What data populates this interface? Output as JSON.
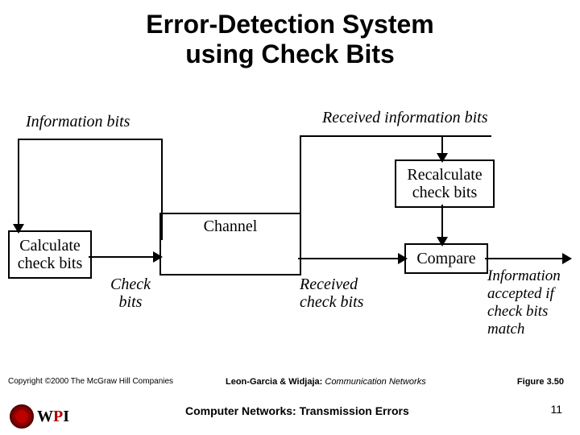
{
  "title_line1": "Error-Detection System",
  "title_line2": "using Check Bits",
  "labels": {
    "info_bits": "Information bits",
    "received_info_bits": "Received information bits",
    "check_bits": "Check bits",
    "received_check_bits": "Received check bits",
    "accepted": "Information accepted if check bits match"
  },
  "boxes": {
    "calc": "Calculate check bits",
    "channel": "Channel",
    "recalc": "Recalculate check bits",
    "compare": "Compare"
  },
  "footer": {
    "copyright": "Copyright ©2000 The McGraw Hill Companies",
    "citation_bold": "Leon-Garcia & Widjaja:",
    "citation_italic": "Communication Networks",
    "figure": "Figure 3.50",
    "netline": "Computer Networks: Transmission Errors",
    "page": "11"
  },
  "logo": {
    "text": "WPI"
  }
}
